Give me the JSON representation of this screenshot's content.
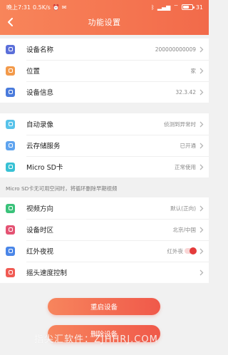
{
  "status_bar": {
    "time": "晚上7:31",
    "speed": "0.5K/s",
    "battery": "31"
  },
  "header": {
    "title": "功能设置"
  },
  "groups": [
    [
      {
        "label": "设备名称",
        "value": "200000000009",
        "icon": "device-icon",
        "color": "#5b6fd9"
      },
      {
        "label": "位置",
        "value": "家",
        "icon": "location-icon",
        "color": "#f39a4a"
      },
      {
        "label": "设备信息",
        "value": "32.3.42",
        "icon": "info-icon",
        "color": "#4a7bdc"
      }
    ],
    [
      {
        "label": "自动录像",
        "value": "侦测到异常时",
        "icon": "record-icon",
        "color": "#58c3ea"
      },
      {
        "label": "云存储服务",
        "value": "已开通",
        "icon": "cloud-icon",
        "color": "#5fa4ef"
      },
      {
        "label": "Micro SD卡",
        "value": "正常使用",
        "icon": "sdcard-icon",
        "color": "#38c1d4"
      }
    ],
    [
      {
        "label": "视频方向",
        "value": "默认(正向)",
        "icon": "rotate-icon",
        "color": "#3ac27a"
      },
      {
        "label": "设备时区",
        "value": "北京/中国",
        "icon": "timezone-icon",
        "color": "#e45373"
      },
      {
        "label": "红外夜视",
        "value": "红外夜",
        "icon": "nightvision-icon",
        "color": "#4a86e8"
      },
      {
        "label": "摇头速度控制",
        "value": "",
        "icon": "ptz-speed-icon",
        "color": "#f05b54"
      }
    ]
  ],
  "note": "Micro SD卡无可用空间时，将循环删除早期视频",
  "buttons": {
    "restart": "重启设备",
    "delete": "删除设备"
  },
  "watermark": "指尖汇软件：ZJHHRJ.COM"
}
